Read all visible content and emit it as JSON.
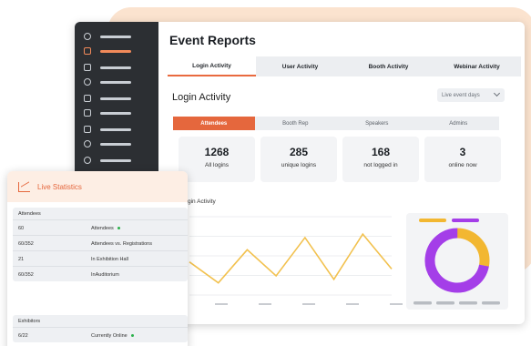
{
  "page": {
    "title": "Event Reports",
    "tabs": [
      "Login Activity",
      "User Activity",
      "Booth Activity",
      "Webinar Activity"
    ],
    "active_tab": 0
  },
  "section": {
    "title": "Login Activity",
    "dropdown_value": "Live event days"
  },
  "subtabs": [
    "Attendees",
    "Booth Rep",
    "Speakers",
    "Admins"
  ],
  "active_subtab": 0,
  "stats": [
    {
      "value": "1268",
      "label": "All logins"
    },
    {
      "value": "285",
      "label": "unique logins"
    },
    {
      "value": "168",
      "label": "not logged in"
    },
    {
      "value": "3",
      "label": "online now"
    }
  ],
  "chart": {
    "title": "gin Activity",
    "line_color": "#f2c14e"
  },
  "chart_data": {
    "type": "line",
    "y": [
      38,
      14,
      52,
      22,
      66,
      18,
      70,
      30
    ],
    "ylim": [
      0,
      90
    ],
    "grid": true,
    "line_color": "#f2c14e"
  },
  "donut": {
    "colors": {
      "primary": "#a43ee8",
      "secondary": "#f2b731",
      "legend_gray": "#b8bcc2"
    },
    "primary_share": 0.72
  },
  "live": {
    "title": "Live Statistics",
    "groups": [
      {
        "title": "Attendees",
        "rows": [
          {
            "value": "60",
            "label": "Attendees",
            "online": true
          },
          {
            "value": "60/352",
            "label": "Attendees vs. Registrations",
            "online": false
          },
          {
            "value": "21",
            "label": "In Exhibition Hall",
            "online": false
          },
          {
            "value": "60/352",
            "label": "InAuditorium",
            "online": false
          }
        ]
      },
      {
        "title": "Exhibitors",
        "rows": [
          {
            "value": "6/22",
            "label": "Currently Online",
            "online": true
          }
        ]
      }
    ]
  },
  "colors": {
    "accent": "#e5673d",
    "sidebar_bg": "#2c2f33",
    "background_blob": "#fbe3cf",
    "online_dot": "#2bb14b"
  }
}
